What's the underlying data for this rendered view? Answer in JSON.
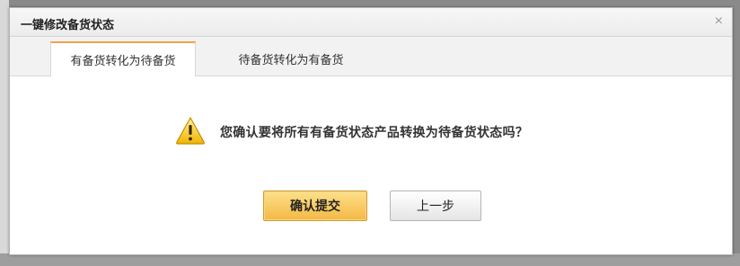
{
  "dialog": {
    "title": "一键修改备货状态",
    "close_glyph": "×"
  },
  "tabs": [
    {
      "label": "有备货转化为待备货",
      "active": true
    },
    {
      "label": "待备货转化为有备货",
      "active": false
    }
  ],
  "content": {
    "icon": "warning-icon",
    "message": "您确认要将所有有备货状态产品转换为待备货状态吗？"
  },
  "buttons": {
    "confirm_label": "确认提交",
    "back_label": "上一步"
  },
  "colors": {
    "accent_tab_border": "#f2a04a",
    "confirm_button": "#f4b845",
    "warning_icon": "#f5c518"
  }
}
